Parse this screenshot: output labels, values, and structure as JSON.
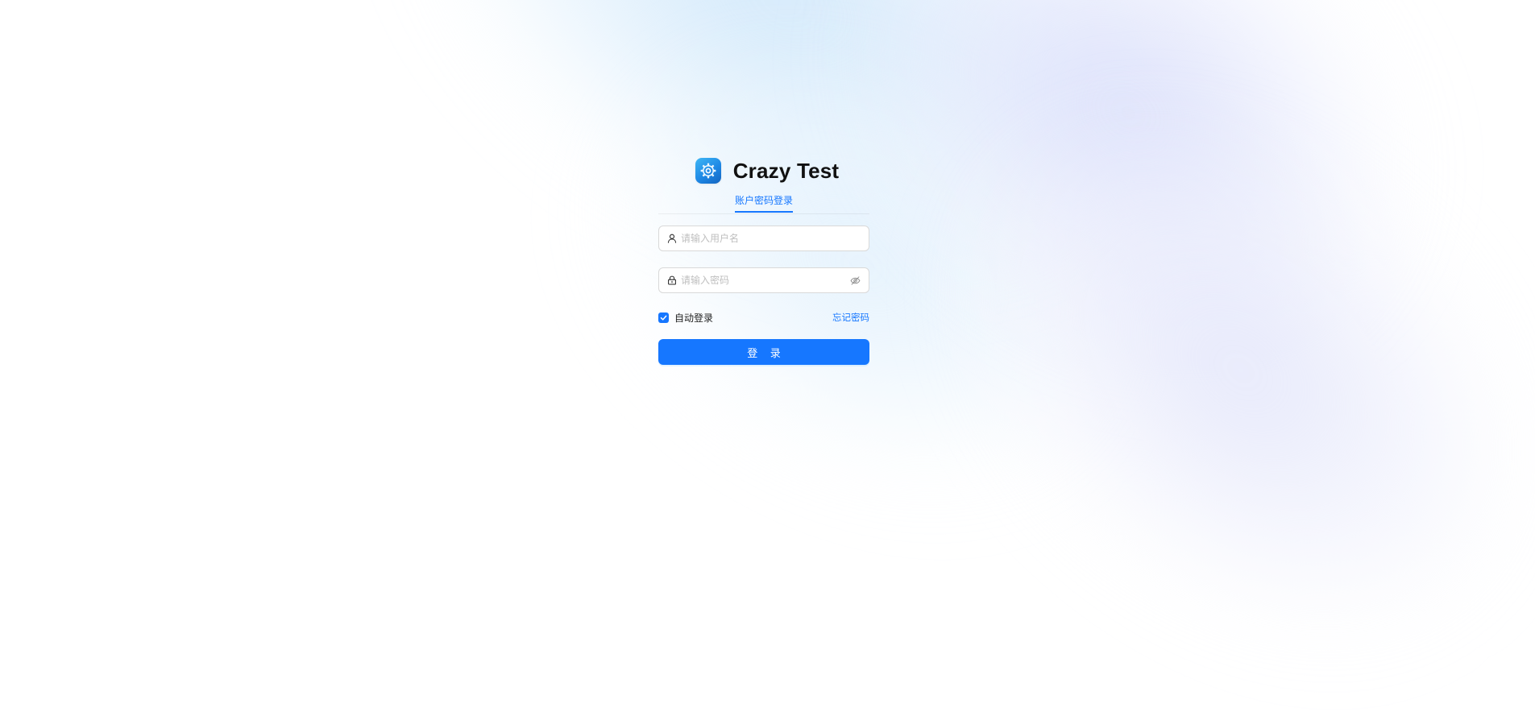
{
  "app": {
    "title": "Crazy Test",
    "logo_icon": "gear-cog-icon"
  },
  "tabs": [
    {
      "label": "账户密码登录",
      "active": true
    }
  ],
  "form": {
    "username": {
      "placeholder": "请输入用户名",
      "value": "",
      "icon": "user-icon"
    },
    "password": {
      "placeholder": "请输入密码",
      "value": "",
      "icon": "lock-icon",
      "toggle_icon": "eye-invisible-icon"
    },
    "remember": {
      "label": "自动登录",
      "checked": true
    },
    "forgot_label": "忘记密码",
    "submit_label": "登 录"
  },
  "colors": {
    "primary": "#1677ff",
    "border": "#d9d9d9",
    "placeholder": "#bfbfbf"
  }
}
